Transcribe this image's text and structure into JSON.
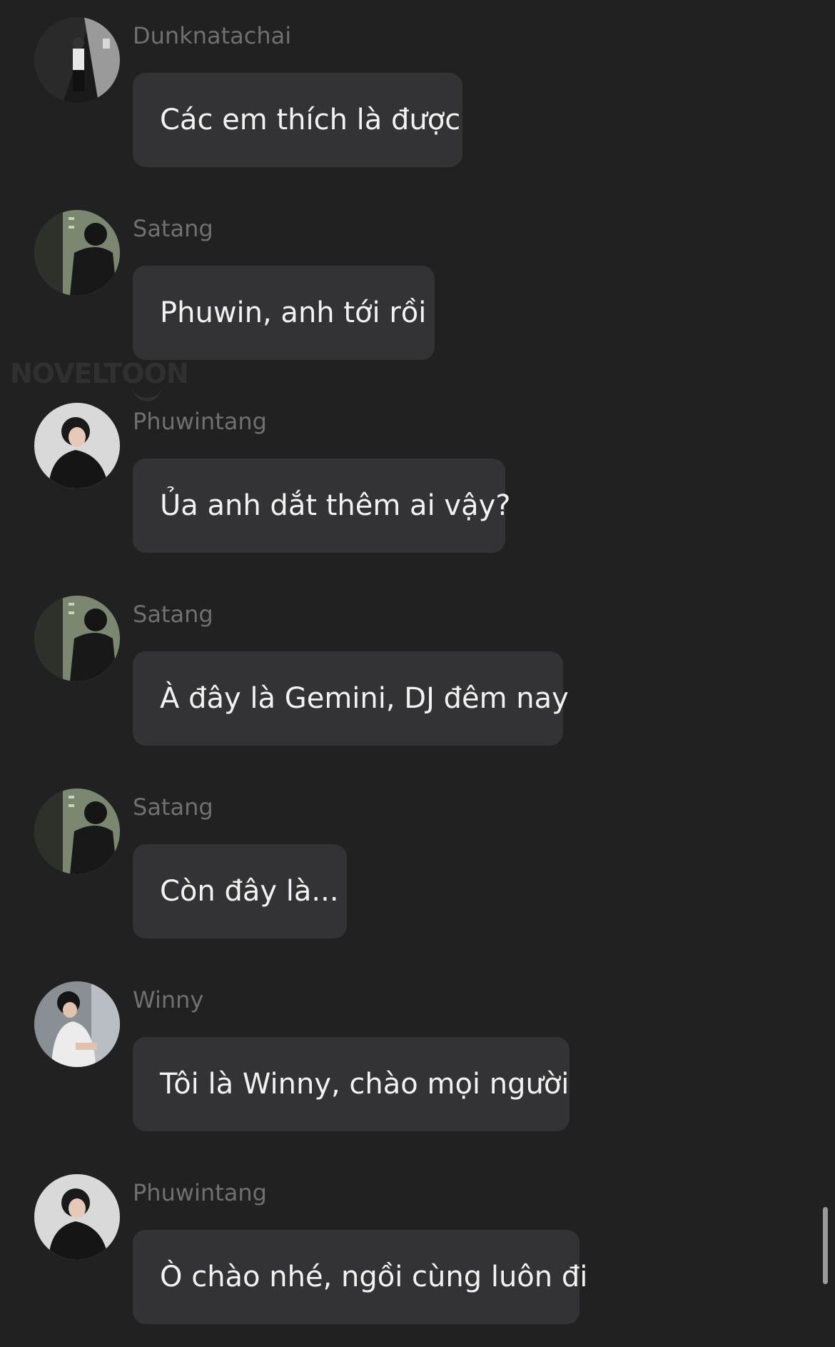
{
  "watermark": "NOVELTOON",
  "messages": [
    {
      "sender": "Dunknatachai",
      "text": "Các em thích là được",
      "avatar": "dunknatachai-avatar"
    },
    {
      "sender": "Satang",
      "text": "Phuwin, anh tới rồi",
      "avatar": "satang-avatar"
    },
    {
      "sender": "Phuwintang",
      "text": "Ủa anh dắt thêm ai vậy?",
      "avatar": "phuwintang-avatar"
    },
    {
      "sender": "Satang",
      "text": "À đây là Gemini, DJ đêm nay",
      "avatar": "satang-avatar"
    },
    {
      "sender": "Satang",
      "text": "Còn đây là...",
      "avatar": "satang-avatar"
    },
    {
      "sender": "Winny",
      "text": "Tôi là Winny, chào mọi người",
      "avatar": "winny-avatar"
    },
    {
      "sender": "Phuwintang",
      "text": "Ò chào nhé, ngồi cùng luôn đi",
      "avatar": "phuwintang-avatar"
    }
  ],
  "colors": {
    "background": "#212122",
    "bubble": "#333335",
    "sender_text": "#707072",
    "message_text": "#f2f2f2"
  }
}
